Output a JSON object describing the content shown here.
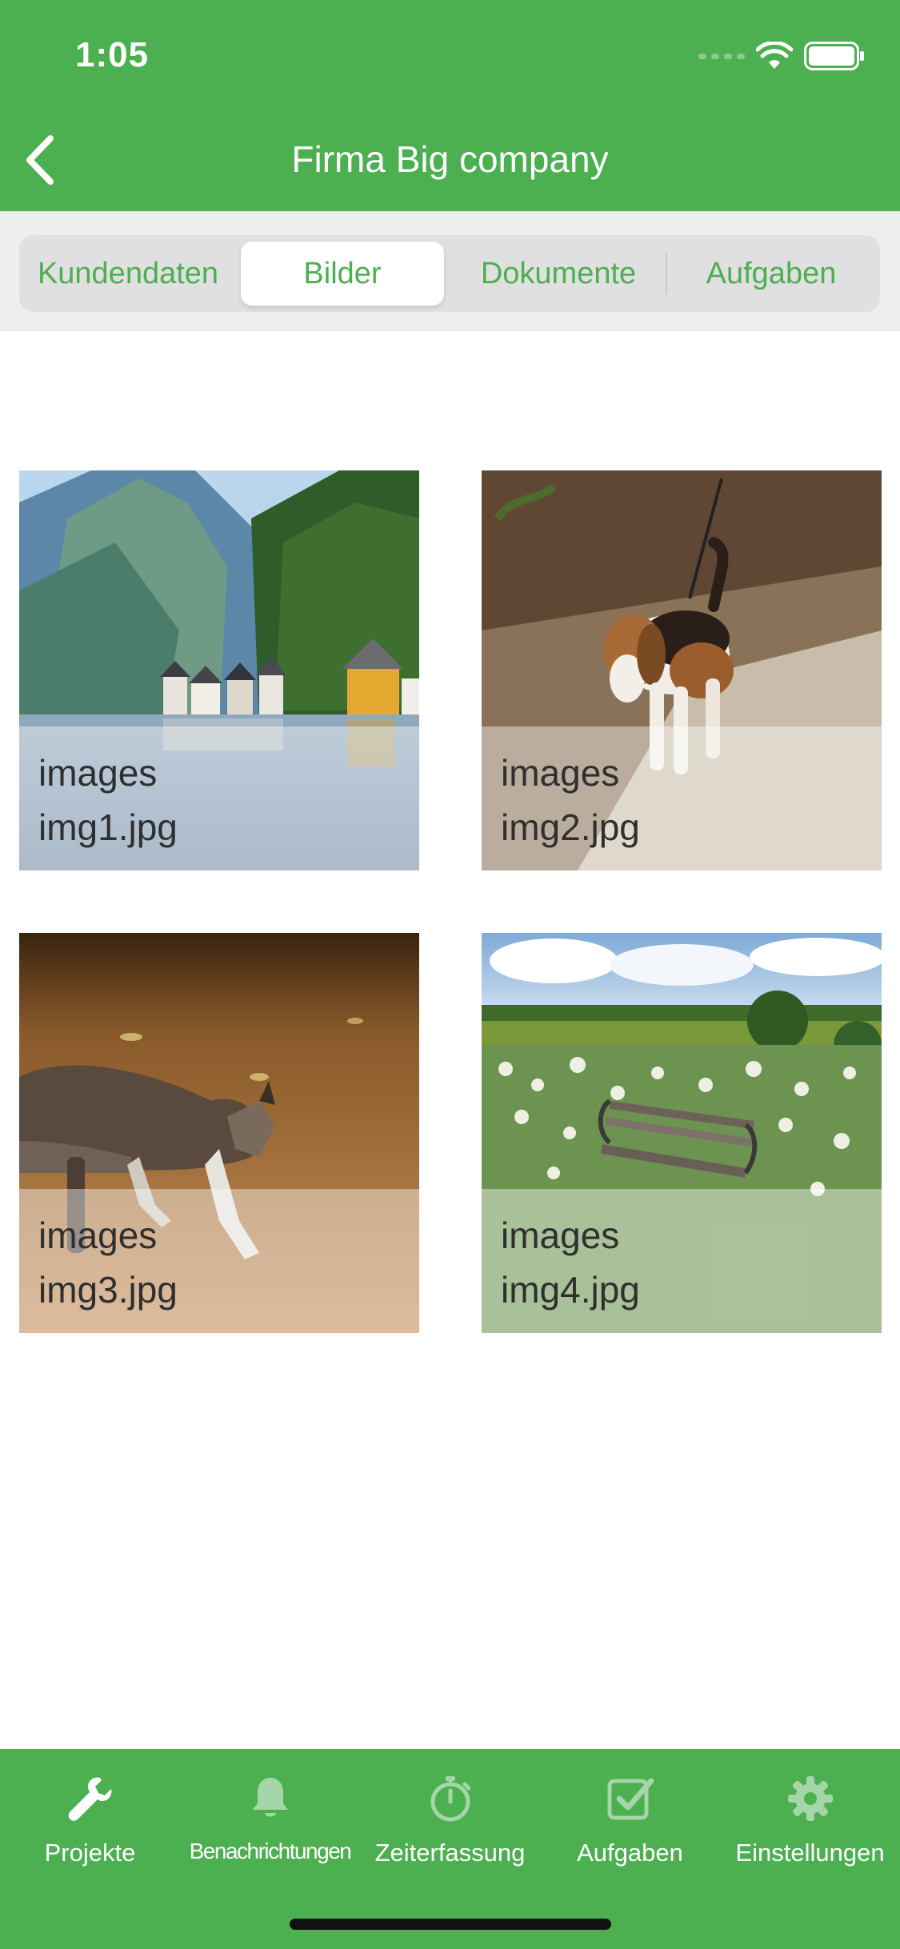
{
  "status_bar": {
    "time": "1:05"
  },
  "header": {
    "title": "Firma Big company",
    "back_icon": "chevron-left-icon"
  },
  "segments": [
    {
      "label": "Kundendaten",
      "active": false
    },
    {
      "label": "Bilder",
      "active": true
    },
    {
      "label": "Dokumente",
      "active": false
    },
    {
      "label": "Aufgaben",
      "active": false
    }
  ],
  "gallery": [
    {
      "folder": "images",
      "file": "img1.jpg"
    },
    {
      "folder": "images",
      "file": "img2.jpg"
    },
    {
      "folder": "images",
      "file": "img3.jpg"
    },
    {
      "folder": "images",
      "file": "img4.jpg"
    }
  ],
  "tabbar": [
    {
      "label": "Projekte",
      "icon": "wrench-icon",
      "active": true
    },
    {
      "label": "Benachrichtungen",
      "icon": "bell-icon",
      "active": false
    },
    {
      "label": "Zeiterfassung",
      "icon": "stopwatch-icon",
      "active": false
    },
    {
      "label": "Aufgaben",
      "icon": "checkbox-icon",
      "active": false
    },
    {
      "label": "Einstellungen",
      "icon": "gear-icon",
      "active": false
    }
  ],
  "colors": {
    "primary": "#4caf50",
    "segment_bg": "#e0e0e0",
    "inactive_icon": "#a5d6a7"
  }
}
